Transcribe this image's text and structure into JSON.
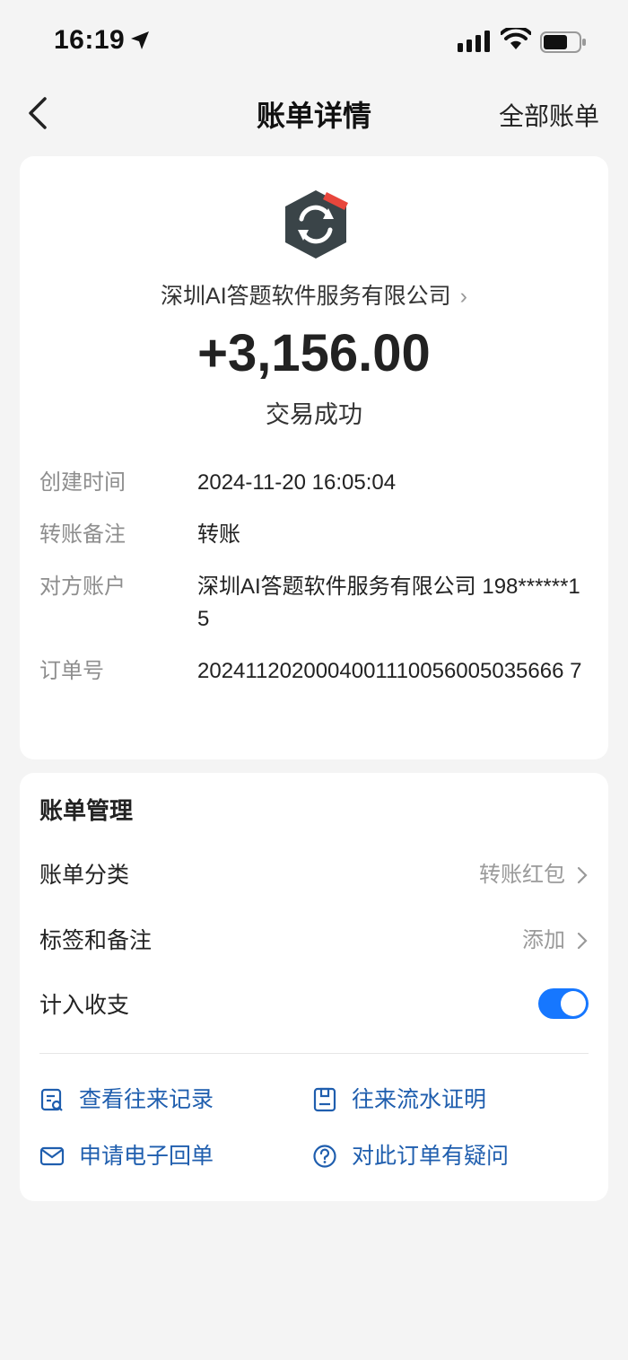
{
  "status_bar": {
    "time": "16:19"
  },
  "nav": {
    "title": "账单详情",
    "right_label": "全部账单"
  },
  "summary": {
    "merchant": "深圳AI答题软件服务有限公司",
    "amount": "+3,156.00",
    "status": "交易成功"
  },
  "details": [
    {
      "label": "创建时间",
      "value": "2024-11-20 16:05:04"
    },
    {
      "label": "转账备注",
      "value": "转账"
    },
    {
      "label": "对方账户",
      "value": "深圳AI答题软件服务有限公司 198******15"
    },
    {
      "label": "订单号",
      "value": "2024112020004001110056005035666 7"
    }
  ],
  "management": {
    "title": "账单管理",
    "category_label": "账单分类",
    "category_value": "转账红包",
    "tag_label": "标签和备注",
    "tag_value": "添加",
    "count_label": "计入收支",
    "count_enabled": true
  },
  "actions": {
    "records": "查看往来记录",
    "proof": "往来流水证明",
    "receipt": "申请电子回单",
    "question": "对此订单有疑问"
  },
  "colors": {
    "accent": "#1677ff",
    "link": "#1f5eae",
    "logo": "#3a4448"
  }
}
